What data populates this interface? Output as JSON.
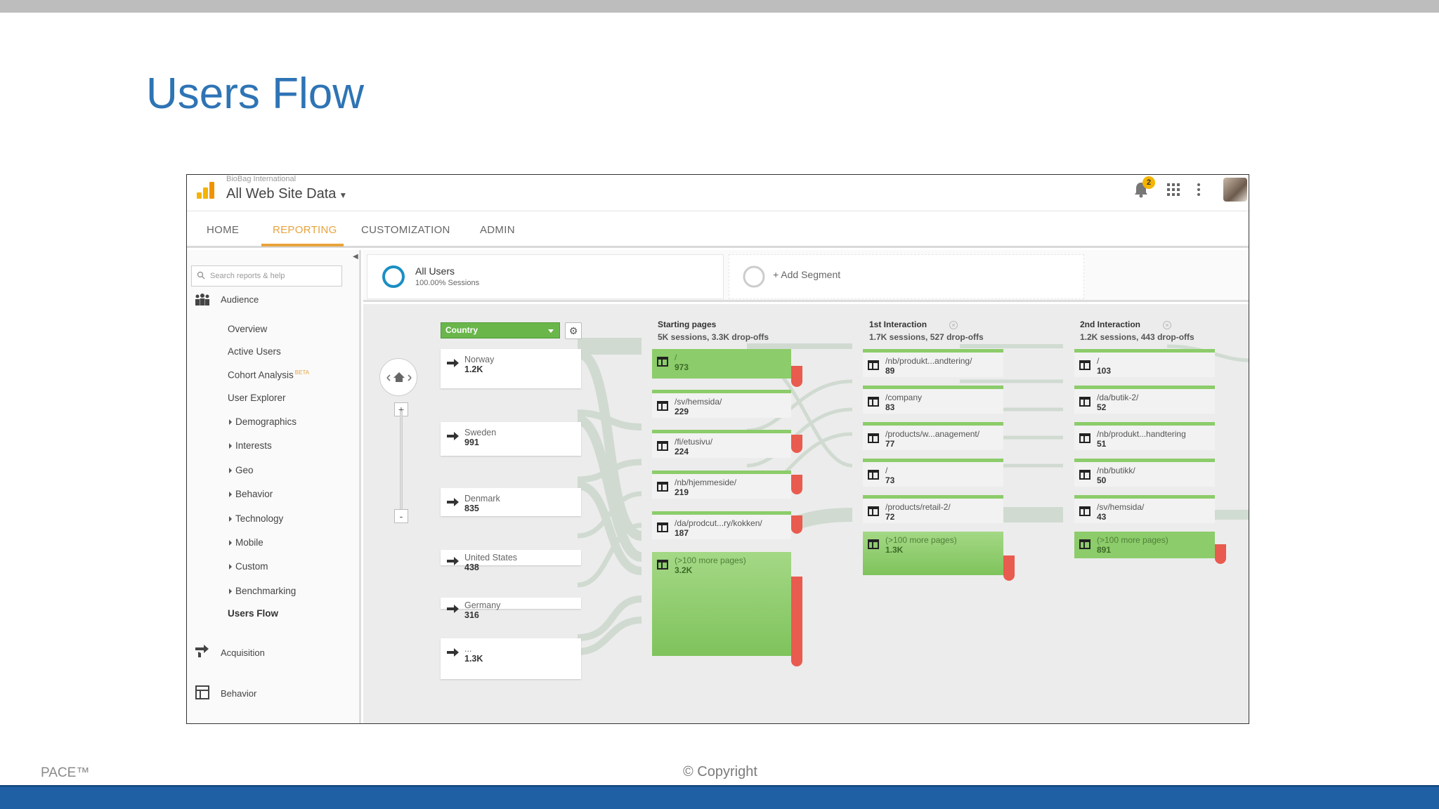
{
  "slide": {
    "title": "Users Flow",
    "footer_left": "PACE™",
    "footer_center": "© Copyright"
  },
  "ga": {
    "account": "BioBag International",
    "property": "All Web Site Data",
    "notifications": "2",
    "tabs": [
      "HOME",
      "REPORTING",
      "CUSTOMIZATION",
      "ADMIN"
    ],
    "active_tab": "REPORTING",
    "accent": "#e8a33d",
    "search_placeholder": "Search reports & help",
    "sidebar": {
      "audience": "Audience",
      "items": [
        "Overview",
        "Active Users",
        "Cohort Analysis",
        "User Explorer"
      ],
      "beta": "BETA",
      "subsections": [
        "Demographics",
        "Interests",
        "Geo",
        "Behavior",
        "Technology",
        "Mobile",
        "Custom",
        "Benchmarking"
      ],
      "active_item": "Users Flow",
      "acquisition": "Acquisition",
      "behavior": "Behavior"
    },
    "segments": {
      "name": "All Users",
      "sub": "100.00% Sessions",
      "add": "+ Add Segment"
    },
    "flow": {
      "dimension": "Country",
      "countries": [
        {
          "name": "Norway",
          "value": "1.2K"
        },
        {
          "name": "Sweden",
          "value": "991"
        },
        {
          "name": "Denmark",
          "value": "835"
        },
        {
          "name": "United States",
          "value": "438"
        },
        {
          "name": "Germany",
          "value": "316"
        },
        {
          "name": "...",
          "value": "1.3K"
        }
      ],
      "columns": [
        {
          "title": "Starting pages",
          "sub": "5K sessions, 3.3K drop-offs"
        },
        {
          "title": "1st Interaction",
          "sub": "1.7K sessions, 527 drop-offs"
        },
        {
          "title": "2nd Interaction",
          "sub": "1.2K sessions, 443 drop-offs"
        }
      ],
      "starting_pages": [
        {
          "name": "/",
          "value": "973"
        },
        {
          "name": "/sv/hemsida/",
          "value": "229"
        },
        {
          "name": "/fi/etusivu/",
          "value": "224"
        },
        {
          "name": "/nb/hjemmeside/",
          "value": "219"
        },
        {
          "name": "/da/prodcut...ry/kokken/",
          "value": "187"
        },
        {
          "name": "(>100 more pages)",
          "value": "3.2K"
        }
      ],
      "first_interaction": [
        {
          "name": "/nb/produkt...andtering/",
          "value": "89"
        },
        {
          "name": "/company",
          "value": "83"
        },
        {
          "name": "/products/w...anagement/",
          "value": "77"
        },
        {
          "name": "/",
          "value": "73"
        },
        {
          "name": "/products/retail-2/",
          "value": "72"
        },
        {
          "name": "(>100 more pages)",
          "value": "1.3K"
        }
      ],
      "second_interaction": [
        {
          "name": "/",
          "value": "103"
        },
        {
          "name": "/da/butik-2/",
          "value": "52"
        },
        {
          "name": "/nb/produkt...handtering",
          "value": "51"
        },
        {
          "name": "/nb/butikk/",
          "value": "50"
        },
        {
          "name": "/sv/hemsida/",
          "value": "43"
        },
        {
          "name": "(>100 more pages)",
          "value": "891"
        }
      ]
    }
  }
}
